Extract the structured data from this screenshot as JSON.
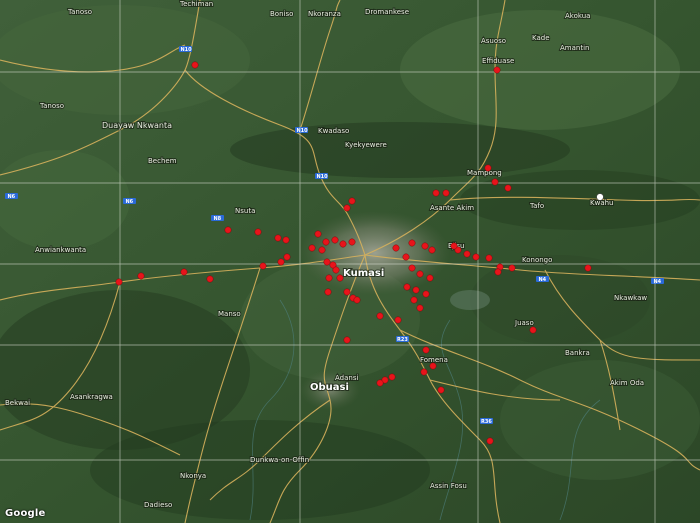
{
  "map": {
    "provider": "Google",
    "colors": {
      "land_green": "#3a5a36",
      "land_dark": "#263f22",
      "urban": "#8f9280",
      "road": "#d9b35a",
      "grid": "#cfd6c8",
      "marker": "#e8141b",
      "marker_outline": "#7a0a0a"
    },
    "places": [
      {
        "name": "Techiman"
      },
      {
        "name": "Tanoso"
      },
      {
        "name": "Boniso"
      },
      {
        "name": "Nkoranza"
      },
      {
        "name": "Dromankese"
      },
      {
        "name": "Akokua"
      },
      {
        "name": "Amantin"
      },
      {
        "name": "Asuoso"
      },
      {
        "name": "Kade"
      },
      {
        "name": "Effiduase"
      },
      {
        "name": "Duayaw Nkwanta"
      },
      {
        "name": "Bechem"
      },
      {
        "name": "Tanoso"
      },
      {
        "name": "Kwadaso"
      },
      {
        "name": "Kyekyewere"
      },
      {
        "name": "Mampong"
      },
      {
        "name": "Asante Akim"
      },
      {
        "name": "Kumasi"
      },
      {
        "name": "Ejisu"
      },
      {
        "name": "Manso"
      },
      {
        "name": "Bekwai"
      },
      {
        "name": "Obuasi"
      },
      {
        "name": "Fomena"
      },
      {
        "name": "Dunkwa-on-Offin"
      },
      {
        "name": "Nkonya"
      },
      {
        "name": "Dadieso"
      },
      {
        "name": "Adansi"
      },
      {
        "name": "Assin Fosu"
      },
      {
        "name": "Juaso"
      },
      {
        "name": "Bankra"
      },
      {
        "name": "Akim Oda"
      },
      {
        "name": "Konongo"
      },
      {
        "name": "Nkawkaw"
      },
      {
        "name": "Tafo"
      },
      {
        "name": "Kwahu"
      },
      {
        "name": "Anwiankwanta"
      },
      {
        "name": "Asankragwa"
      },
      {
        "name": "Nsuta"
      }
    ],
    "roads": [
      {
        "label": "N10"
      },
      {
        "label": "N10"
      },
      {
        "label": "N10"
      },
      {
        "label": "N6"
      },
      {
        "label": "N8"
      },
      {
        "label": "N6"
      },
      {
        "label": "R36"
      },
      {
        "label": "N4"
      },
      {
        "label": "N4"
      },
      {
        "label": "R23"
      }
    ]
  }
}
